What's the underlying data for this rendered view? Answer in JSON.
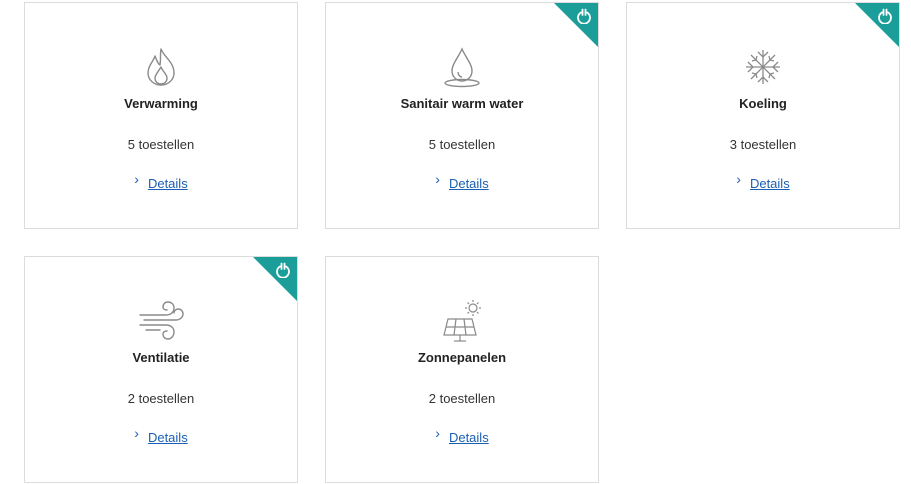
{
  "cards": [
    {
      "title": "Verwarming",
      "count": "5 toestellen",
      "details_label": "Details",
      "icon": "flame-icon",
      "badge": false
    },
    {
      "title": "Sanitair warm water",
      "count": "5 toestellen",
      "details_label": "Details",
      "icon": "water-drop-icon",
      "badge": true
    },
    {
      "title": "Koeling",
      "count": "3 toestellen",
      "details_label": "Details",
      "icon": "snowflake-icon",
      "badge": true
    },
    {
      "title": "Ventilatie",
      "count": "2 toestellen",
      "details_label": "Details",
      "icon": "wind-icon",
      "badge": true
    },
    {
      "title": "Zonnepanelen",
      "count": "2 toestellen",
      "details_label": "Details",
      "icon": "solar-panel-icon",
      "badge": false
    }
  ],
  "colors": {
    "accent": "#1b9e99",
    "link": "#1a5fb4",
    "border": "#dcdcdc",
    "icon": "#8a8a8a"
  },
  "badge_icon": "power-icon"
}
